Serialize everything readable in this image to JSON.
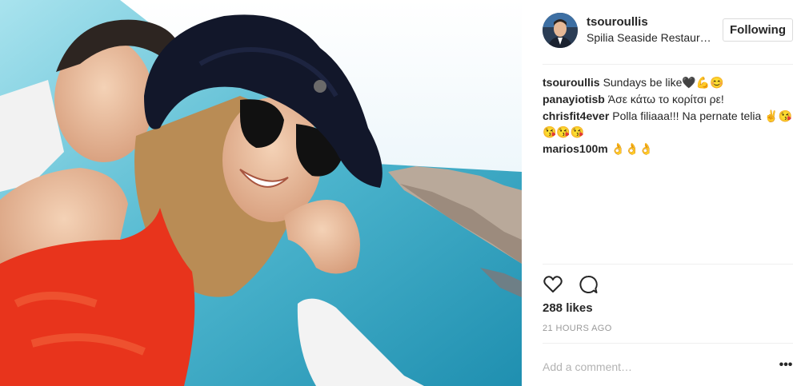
{
  "post": {
    "username": "tsouroullis",
    "location": "Spilia Seaside Restaurant",
    "follow_label": "Following",
    "comments": [
      {
        "user": "tsouroullis",
        "text": "Sundays be like🖤💪😊"
      },
      {
        "user": "panayiotisb",
        "text": "Άσε κάτω το κορίτσι ρε!"
      },
      {
        "user": "chrisfit4ever",
        "text": "Polla filiaaa!!! Na pernate telia ✌😘😘😘😘"
      },
      {
        "user": "marios100m",
        "text": "👌👌👌"
      }
    ],
    "likes": "288 likes",
    "time": "21 HOURS AGO",
    "add_comment_placeholder": "Add a comment…",
    "more_label": "•••"
  },
  "colors": {
    "text": "#262626",
    "muted": "#999999",
    "border": "#dbdbdb",
    "sea": "#7fc9d9",
    "dress": "#e8341c"
  },
  "icons": [
    "heart-icon",
    "comment-icon",
    "more-options-icon"
  ]
}
